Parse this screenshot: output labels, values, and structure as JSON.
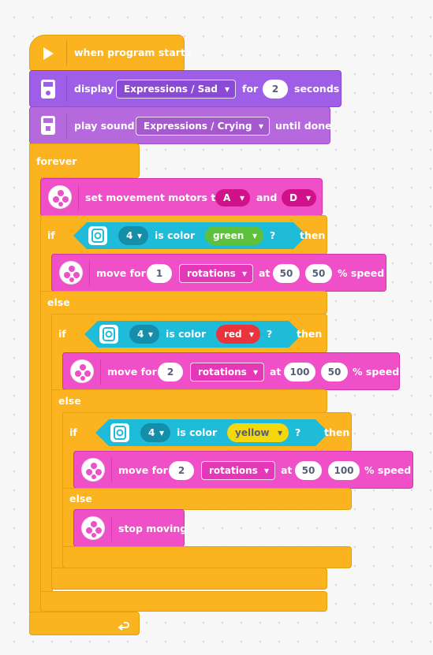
{
  "program": {
    "start_block": {
      "label": "when program starts"
    },
    "display_block": {
      "label": "display",
      "image": "Expressions / Sad",
      "for_label": "for",
      "duration": "2",
      "unit": "seconds"
    },
    "sound_block": {
      "label": "play sound",
      "sound": "Expressions / Crying",
      "mode": "until done"
    },
    "forever_block": {
      "label": "forever"
    },
    "movement_motors_block": {
      "label": "set movement motors to",
      "motor_a": "A",
      "and_label": "and",
      "motor_b": "D"
    },
    "if1": {
      "if_label": "if",
      "port": "4",
      "condition": "is color",
      "color": "green",
      "q": "?",
      "then_label": "then",
      "move": {
        "label": "move for",
        "amount": "1",
        "unit": "rotations",
        "at_label": "at",
        "speed_left": "50",
        "speed_right": "50",
        "speed_label": "% speed"
      },
      "else_label": "else"
    },
    "if2": {
      "if_label": "if",
      "port": "4",
      "condition": "is color",
      "color": "red",
      "q": "?",
      "then_label": "then",
      "move": {
        "label": "move for",
        "amount": "2",
        "unit": "rotations",
        "at_label": "at",
        "speed_left": "100",
        "speed_right": "50",
        "speed_label": "% speed"
      },
      "else_label": "else"
    },
    "if3": {
      "if_label": "if",
      "port": "4",
      "condition": "is color",
      "color": "yellow",
      "q": "?",
      "then_label": "then",
      "move": {
        "label": "move for",
        "amount": "2",
        "unit": "rotations",
        "at_label": "at",
        "speed_left": "50",
        "speed_right": "100",
        "speed_label": "% speed"
      },
      "else_label": "else",
      "stop": {
        "label": "stop moving"
      }
    },
    "loop_icon": "loop-arrow-icon"
  },
  "colors": {
    "events": "#fbb31f",
    "display": "#9e5ee8",
    "sound": "#b669dd",
    "movement": "#ef4fc7",
    "sensor": "#1fbcda",
    "green": "#5ec13d",
    "red": "#e8343d",
    "yellow": "#f5d80b"
  }
}
